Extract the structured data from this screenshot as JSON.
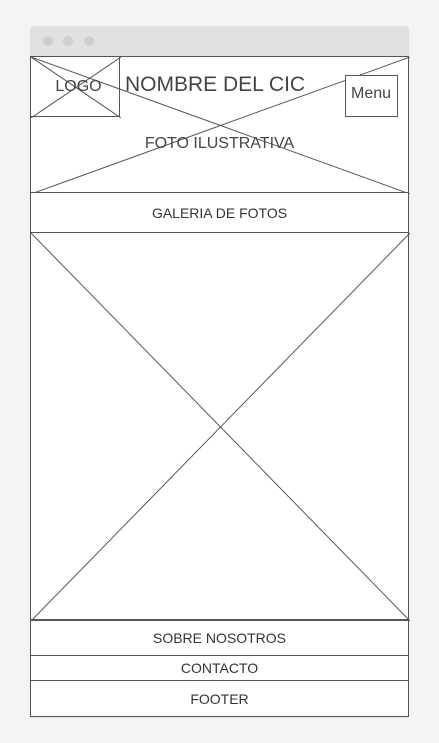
{
  "header": {
    "logo_label": "LOGO",
    "site_name": "NOMBRE DEL CIC",
    "menu_label": "Menu",
    "hero_label": "FOTO ILUSTRATIVA"
  },
  "gallery": {
    "title": "GALERIA DE FOTOS"
  },
  "sections": {
    "about": "SOBRE NOSOTROS",
    "contact": "CONTACTO"
  },
  "footer": {
    "label": "FOOTER"
  },
  "colors": {
    "page_bg": "#f4f4f4",
    "titlebar": "#e1e1e1",
    "window_dot": "#cfcfcf",
    "stroke": "#555555"
  }
}
